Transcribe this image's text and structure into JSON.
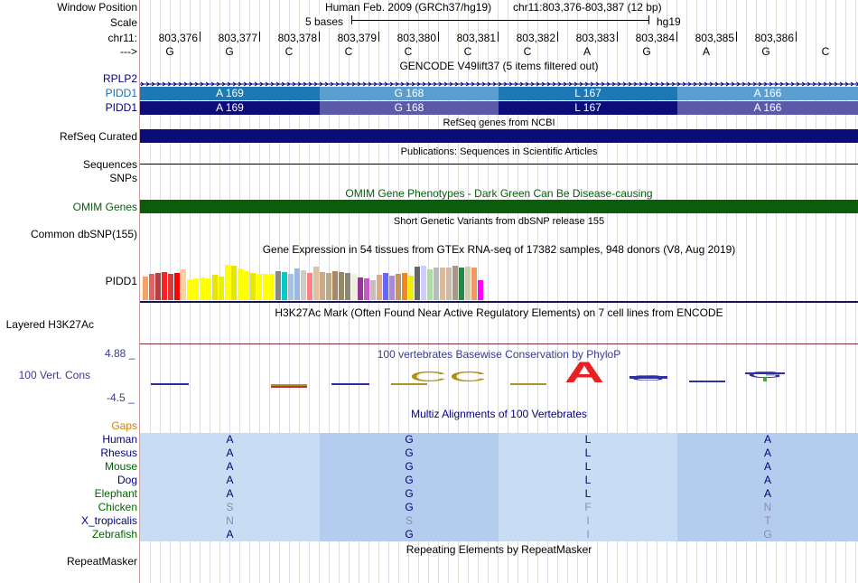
{
  "header": {
    "labels": {
      "window_position": "Window Position",
      "scale": "Scale",
      "chrom": "chr11:",
      "strand": "--->"
    },
    "title_assembly": "Human Feb. 2009 (GRCh37/hg19)",
    "title_position": "chr11:803,376-803,387 (12 bp)",
    "scale_text": "5 bases",
    "scale_assembly": "hg19",
    "positions": [
      "803,376",
      "803,377",
      "803,378",
      "803,379",
      "803,380",
      "803,381",
      "803,382",
      "803,383",
      "803,384",
      "803,385",
      "803,386"
    ],
    "bases": [
      "G",
      "G",
      "C",
      "C",
      "C",
      "C",
      "C",
      "A",
      "G",
      "A",
      "G",
      "C"
    ]
  },
  "gencode": {
    "title": "GENCODE V49lift37 (5 items filtered out)",
    "rows": [
      {
        "label": "RPLP2",
        "label_color": "#000080"
      },
      {
        "label": "PIDD1",
        "label_color": "#1a6fb5",
        "segments": [
          "A 169",
          "G 168",
          "L 167",
          "A 166"
        ],
        "colors": [
          "#1e78b4",
          "#5b9fd0",
          "#1e78b4",
          "#5b9fd0"
        ]
      },
      {
        "label": "PIDD1",
        "label_color": "#000080",
        "segments": [
          "A 169",
          "G 168",
          "L 167",
          "A 166"
        ],
        "colors": [
          "#0c0c7a",
          "#5a5aa8",
          "#0c0c7a",
          "#5a5aa8"
        ]
      }
    ]
  },
  "refseq": {
    "title": "RefSeq genes from NCBI",
    "label": "RefSeq Curated",
    "color": "#0c0c78"
  },
  "publications": {
    "title": "Publications: Sequences in Scientific Articles",
    "label_sequences": "Sequences",
    "label_snps": "SNPs"
  },
  "omim": {
    "title": "OMIM Gene Phenotypes - Dark Green Can Be Disease-causing",
    "label": "OMIM Genes",
    "color": "#0b5c0b"
  },
  "dbsnp": {
    "title": "Short Genetic Variants from dbSNP release 155",
    "label": "Common dbSNP(155)"
  },
  "gtex": {
    "title": "Gene Expression in 54 tissues from GTEx RNA-seq of 17382 samples, 948 donors (V8, Aug 2019)",
    "label": "PIDD1",
    "levels": [
      0.55,
      0.6,
      0.62,
      0.65,
      0.6,
      0.62,
      0.7,
      0.48,
      0.5,
      0.52,
      0.5,
      0.58,
      0.55,
      0.82,
      0.8,
      0.72,
      0.66,
      0.63,
      0.6,
      0.6,
      0.6,
      0.66,
      0.64,
      0.6,
      0.72,
      0.68,
      0.62,
      0.78,
      0.65,
      0.62,
      0.66,
      0.64,
      0.63,
      0.6,
      0.52,
      0.5,
      0.46,
      0.58,
      0.62,
      0.56,
      0.6,
      0.62,
      0.56,
      0.78,
      0.8,
      0.7,
      0.76,
      0.76,
      0.75,
      0.8,
      0.75,
      0.78,
      0.75,
      0.45
    ],
    "colors": [
      "#f4a460",
      "#dc6464",
      "#b44040",
      "#ff2020",
      "#d23c3c",
      "#ff0000",
      "#ffd0a0",
      "#ffff00",
      "#ffff00",
      "#ffff00",
      "#ffff00",
      "#e6e600",
      "#eeee00",
      "#ffff00",
      "#e6e600",
      "#ffff00",
      "#ffff00",
      "#e8e800",
      "#ffff00",
      "#ffff00",
      "#ffff00",
      "#888888",
      "#00cccc",
      "#aac0e0",
      "#9bb9e0",
      "#cccccc",
      "#ff8080",
      "#e0c0a0",
      "#ccaa88",
      "#bbaa88",
      "#aa8866",
      "#998866",
      "#888877",
      "#eeeedd",
      "#993399",
      "#cc55cc",
      "#ccbbbb",
      "#ddaa88",
      "#6666ff",
      "#aa88dd",
      "#bb9966",
      "#ee8822",
      "#eeee00",
      "#666666",
      "#ccccff",
      "#aaddaa",
      "#bbbbbb",
      "#ddbb99",
      "#ccbbaa",
      "#aa9988",
      "#228844",
      "#ccccaa",
      "#ee9966",
      "#ff00ff"
    ]
  },
  "h3k27ac": {
    "title": "H3K27Ac Mark (Often Found Near Active Regulatory Elements) on 7 cell lines from ENCODE",
    "label": "Layered H3K27Ac"
  },
  "conservation": {
    "title": "100 vertebrates Basewise Conservation by PhyloP",
    "label": "100 Vert. Cons",
    "y_max": "4.88 _",
    "y_min": "-4.5 _",
    "letters": [
      "C",
      "C",
      "A",
      "G",
      "G"
    ]
  },
  "multiz": {
    "title": "Multiz Alignments of 100 Vertebrates",
    "gaps_label": "Gaps",
    "species": [
      {
        "name": "Human",
        "color": "#000080",
        "aa": [
          "A",
          "G",
          "L",
          "A"
        ],
        "faded": [
          false,
          false,
          false,
          false
        ]
      },
      {
        "name": "Rhesus",
        "color": "#000080",
        "aa": [
          "A",
          "G",
          "L",
          "A"
        ],
        "faded": [
          false,
          false,
          false,
          false
        ]
      },
      {
        "name": "Mouse",
        "color": "#006400",
        "aa": [
          "A",
          "G",
          "L",
          "A"
        ],
        "faded": [
          false,
          false,
          false,
          false
        ]
      },
      {
        "name": "Dog",
        "color": "#000080",
        "aa": [
          "A",
          "G",
          "L",
          "A"
        ],
        "faded": [
          false,
          false,
          false,
          false
        ]
      },
      {
        "name": "Elephant",
        "color": "#006400",
        "aa": [
          "A",
          "G",
          "L",
          "A"
        ],
        "faded": [
          false,
          false,
          false,
          false
        ]
      },
      {
        "name": "Chicken",
        "color": "#006400",
        "aa": [
          "S",
          "G",
          "F",
          "N"
        ],
        "faded": [
          true,
          false,
          true,
          true
        ]
      },
      {
        "name": "X_tropicalis",
        "color": "#000080",
        "aa": [
          "N",
          "S",
          "I",
          "T"
        ],
        "faded": [
          true,
          true,
          true,
          true
        ]
      },
      {
        "name": "Zebrafish",
        "color": "#006400",
        "aa": [
          "A",
          "G",
          "I",
          "G"
        ],
        "faded": [
          false,
          false,
          true,
          true
        ]
      }
    ]
  },
  "repeatmasker": {
    "title": "Repeating Elements by RepeatMasker",
    "label": "RepeatMasker"
  }
}
